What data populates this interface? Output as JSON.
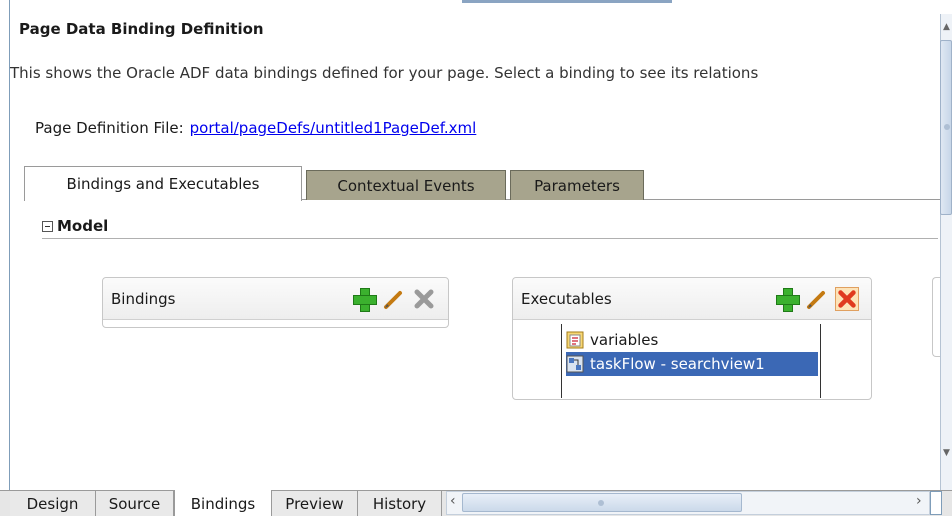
{
  "title": "Page Data Binding Definition",
  "description": "This shows the Oracle ADF data bindings defined for your page. Select a binding to see its relations",
  "page_definition": {
    "label": "Page Definition File:",
    "link": "portal/pageDefs/untitled1PageDef.xml"
  },
  "tabs": [
    {
      "label": "Bindings and Executables",
      "active": true
    },
    {
      "label": "Contextual Events",
      "active": false
    },
    {
      "label": "Parameters",
      "active": false
    }
  ],
  "section": {
    "label": "Model"
  },
  "bindings_panel": {
    "title": "Bindings"
  },
  "executables_panel": {
    "title": "Executables",
    "items": [
      {
        "label": "variables",
        "icon": "variables-icon",
        "selected": false
      },
      {
        "label": "taskFlow - searchview1",
        "icon": "taskflow-icon",
        "selected": true
      }
    ]
  },
  "bottom_tabs": [
    {
      "label": "Design",
      "active": false
    },
    {
      "label": "Source",
      "active": false
    },
    {
      "label": "Bindings",
      "active": true
    },
    {
      "label": "Preview",
      "active": false
    },
    {
      "label": "History",
      "active": false
    }
  ],
  "colors": {
    "selection": "#3b68b5",
    "inactive_tab": "#a7a48d",
    "add_green": "#3bb12e",
    "delete_red": "#e03a1e",
    "link": "#0000ee"
  }
}
